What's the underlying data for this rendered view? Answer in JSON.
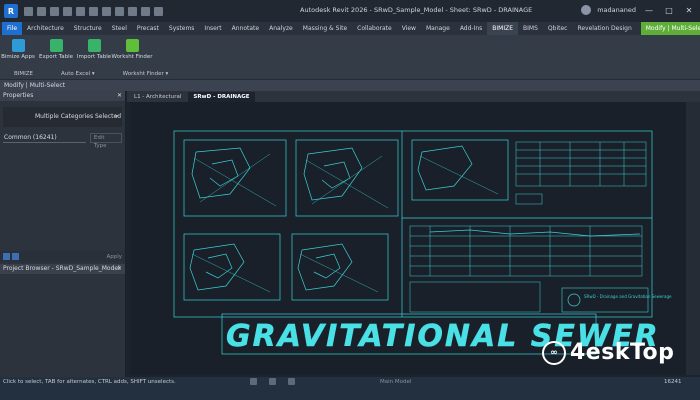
{
  "window": {
    "title": "Autodesk Revit 2026 - SRwD_Sample_Model - Sheet: SRwD - DRAINAGE",
    "user": "madananed"
  },
  "ribbon_tabs": [
    "File",
    "Architecture",
    "Structure",
    "Steel",
    "Precast",
    "Systems",
    "Insert",
    "Annotate",
    "Analyze",
    "Massing & Site",
    "Collaborate",
    "View",
    "Manage",
    "Add-Ins",
    "BIMIZE",
    "BIMS",
    "Qbitec",
    "Revelation Design"
  ],
  "context_tab": "Modify | Multi-Select",
  "ribbon": {
    "tools": [
      {
        "label": "Bimize Apps",
        "color": "#2e9bd6"
      },
      {
        "label": "Export Table",
        "color": "#39b36a"
      },
      {
        "label": "Import Table",
        "color": "#39b36a"
      },
      {
        "label": "Worksht Finder",
        "color": "#5fbe3a"
      }
    ],
    "panels": [
      "BIMIZE",
      "Auto Excel ▾",
      "Worksht Finder ▾"
    ]
  },
  "options_bar": "Modify | Multi-Select",
  "properties": {
    "title": "Properties",
    "close": "✕",
    "type": "Multiple Categories Selected",
    "filter": "Common (16241)",
    "edit_type": "Edit Type",
    "apply": "Apply"
  },
  "project_browser": {
    "title": "Project Browser - SRwD_Sample_Model",
    "close": "✕"
  },
  "doc_tabs": [
    "L1 - Architectural",
    "SRwD - DRAINAGE"
  ],
  "sheet": {
    "banner": "GRAVITATIONAL SEWER",
    "title_block": "SRwD - Drainage and Gravitation Sewerage"
  },
  "status": {
    "hint": "Click to select, TAB for alternates, CTRL adds, SHIFT unselects.",
    "model": "Main Model",
    "count": "16241"
  },
  "watermark": "4eskTop",
  "colors": {
    "linework": "#3ad0d6",
    "banner": "#49e0e6",
    "file_tab": "#1f6fd1",
    "context_tab": "#5fae3a"
  }
}
